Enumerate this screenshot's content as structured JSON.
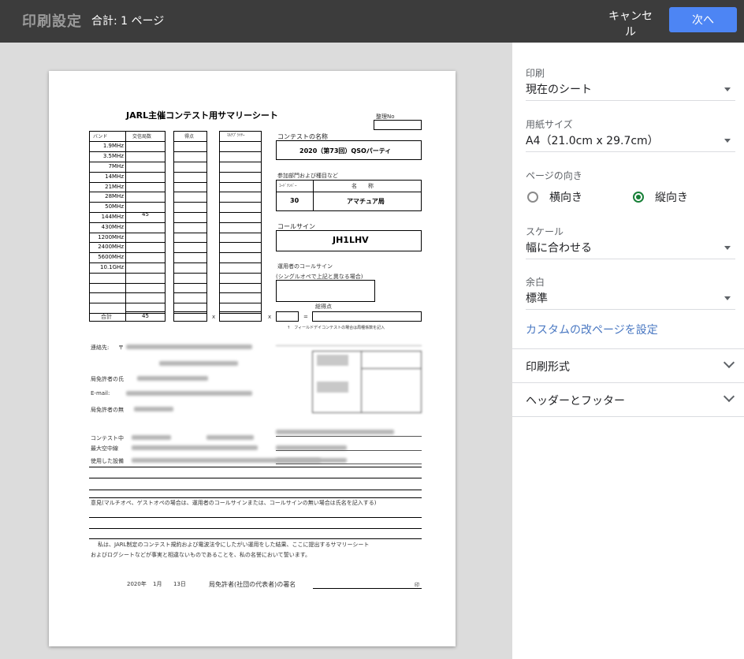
{
  "header": {
    "title": "印刷設定",
    "page_count": "合計: 1 ページ",
    "cancel_label": "キャンセル",
    "next_label": "次へ"
  },
  "settings": {
    "print": {
      "label": "印刷",
      "value": "現在のシート"
    },
    "paper_size": {
      "label": "用紙サイズ",
      "value": "A4（21.0cm x 29.7cm）"
    },
    "orientation": {
      "label": "ページの向き",
      "landscape": "横向き",
      "portrait": "縦向き",
      "selected": "portrait"
    },
    "scale": {
      "label": "スケール",
      "value": "幅に合わせる"
    },
    "margin": {
      "label": "余白",
      "value": "標準"
    },
    "custom_page_breaks": "カスタムの改ページを設定",
    "print_format": "印刷形式",
    "header_footer": "ヘッダーとフッター"
  },
  "document": {
    "title": "JARL主催コンテスト用サマリーシート",
    "serial_label": "整理No",
    "col_band": "バンド",
    "col_qso": "交信局数",
    "col_points": "得点",
    "col_multiplier": "ﾏﾙﾁﾌﾟﾗｲﾔｰ",
    "bands": [
      "1.9MHz",
      "3.5MHz",
      "7MHz",
      "14MHz",
      "21MHz",
      "28MHz",
      "50MHz",
      "144MHz",
      "430MHz",
      "1200MHz",
      "2400MHz",
      "5600MHz",
      "10.1GHz"
    ],
    "qso_144": "45",
    "total_label": "合計",
    "total_qso": "45",
    "times_1": "x",
    "times_2": "x",
    "equals": "=",
    "contest_name_label": "コンテストの名称",
    "contest_name": "2020（第73回）QSOパーティ",
    "category_label": "参加部門および種目など",
    "code_number_label": "ｺｰﾄﾞﾅﾝﾊﾞｰ",
    "name_label": "名　　称",
    "code_number": "30",
    "category_name": "アマチュア局",
    "callsign_label": "コールサイン",
    "callsign": "JH1LHV",
    "operator_callsign_label": "運用者のコールサイン",
    "operator_note": "(シングルオペで上記と異なる場合)",
    "total_points_label": "総得点",
    "field_day_note": "↑　フィールドデイコンテストの場合は局種係数を記入",
    "contact_label": "連絡先:",
    "postal_mark": "〒",
    "licensee_name_label": "局免許者の氏",
    "email_label": "E-mail:",
    "licensee_location_label": "局免許者の無",
    "contest_station_label": "コンテスト中",
    "max_power_label": "最大空中線",
    "equipment_label": "使用した設備",
    "opinion_label": "意見(マルチオペ、ゲストオペの場合は、運用者のコールサインまたは、コールサインの無い場合は氏名を記入する)",
    "oath_line1": "私は、JARL制定のコンテスト規約および電波法令にしたがい運用をした結果、ここに提出するサマリーシート",
    "oath_line2": "およびログシートなどが事実と相違ないものであることを、私の名誉において誓います。",
    "date_year": "2020年",
    "date_month": "1月",
    "date_day": "13日",
    "signature_label": "局免許者(社団の代表者)の署名",
    "seal_mark": "印"
  }
}
